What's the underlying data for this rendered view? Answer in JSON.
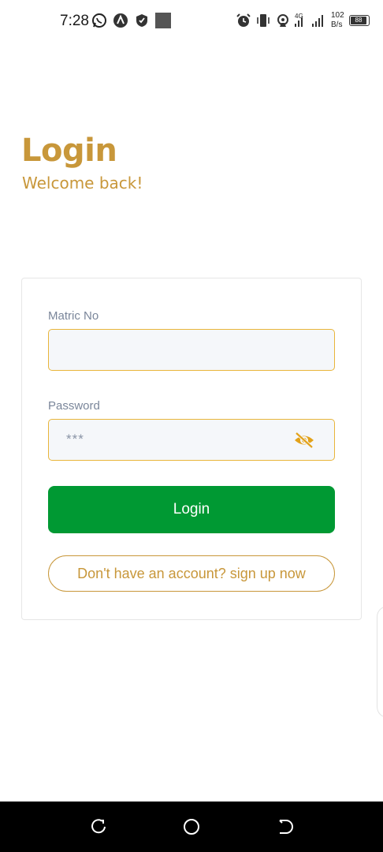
{
  "status_bar": {
    "time": "7:28",
    "network_speed_value": "102",
    "network_speed_unit": "B/s",
    "battery": "88",
    "signal_label": "4G",
    "icons": [
      "whatsapp-icon",
      "vpn-icon",
      "shield-icon",
      "notification-square-icon",
      "alarm-icon",
      "vibrate-icon",
      "hotspot-icon",
      "signal-icon",
      "battery-icon"
    ]
  },
  "header": {
    "title": "Login",
    "subtitle": "Welcome back!"
  },
  "form": {
    "matric_label": "Matric No",
    "matric_value": "",
    "password_label": "Password",
    "password_value": "***",
    "login_label": "Login",
    "signup_label": "Don't have an account? sign up now"
  },
  "colors": {
    "accent_gold": "#c8973a",
    "input_border": "#e9b53a",
    "primary_green": "#009933",
    "eye_icon": "#e3a21a"
  },
  "nav_bar": {
    "icons": [
      "recents-icon",
      "home-icon",
      "back-icon"
    ]
  }
}
